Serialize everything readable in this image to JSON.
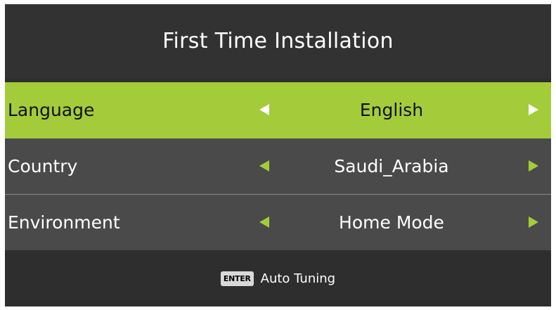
{
  "title": "First Time Installation",
  "colors": {
    "accent": "#a4cc3a",
    "row_bg": "#4a4a4a",
    "panel_bg": "#2e2e2e"
  },
  "rows": [
    {
      "label": "Language",
      "value": "English",
      "selected": true,
      "left_icon": "triangle-left-icon",
      "right_icon": "triangle-right-icon"
    },
    {
      "label": "Country",
      "value": "Saudi_Arabia",
      "selected": false,
      "left_icon": "triangle-left-icon",
      "right_icon": "triangle-right-icon"
    },
    {
      "label": "Environment",
      "value": "Home Mode",
      "selected": false,
      "left_icon": "triangle-left-icon",
      "right_icon": "triangle-right-icon"
    }
  ],
  "footer": {
    "key_label": "ENTER",
    "action_label": "Auto Tuning"
  }
}
